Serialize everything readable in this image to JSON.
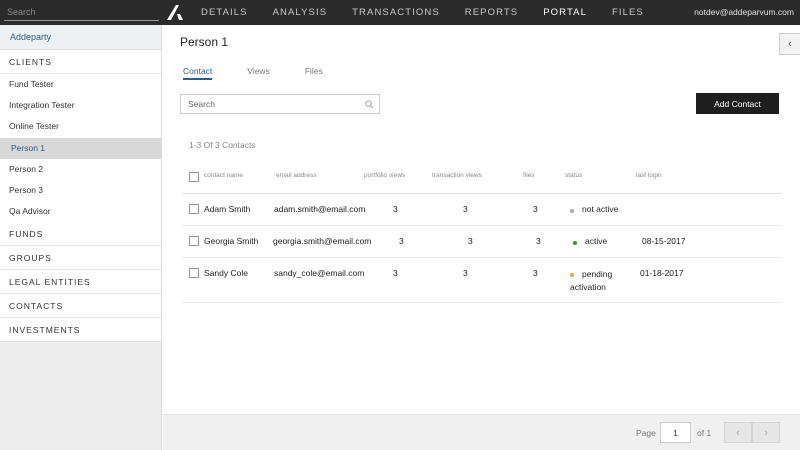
{
  "topbar": {
    "search_placeholder": "Search",
    "nav": [
      "DETAILS",
      "ANALYSIS",
      "TRANSACTIONS",
      "REPORTS",
      "PORTAL",
      "FILES"
    ],
    "active_nav": "PORTAL",
    "user_email": "notdev@addeparvum.com"
  },
  "sidebar": {
    "firm": "Addeparty",
    "clients_header": "CLIENTS",
    "clients": [
      "Fund Tester",
      "Integration Tester",
      "Online Tester",
      "Person 1",
      "Person 2",
      "Person 3",
      "Qa Advisor"
    ],
    "selected_client": "Person 1",
    "sections": [
      "FUNDS",
      "GROUPS",
      "LEGAL ENTITIES",
      "CONTACTS",
      "INVESTMENTS"
    ]
  },
  "main": {
    "title": "Person 1",
    "tabs": [
      "Contact",
      "Views",
      "Files"
    ],
    "active_tab": "Contact",
    "search_placeholder": "Search",
    "add_button": "Add Contact",
    "count_text": "1-3 Of 3 Contacts",
    "columns": [
      "contact name",
      "email address",
      "portfolio views",
      "transaction views",
      "files",
      "status",
      "last login"
    ],
    "rows": [
      {
        "name": "Adam Smith",
        "email": "adam.smith@email.com",
        "portfolio_views": "3",
        "transaction_views": "3",
        "files": "3",
        "status": "not active",
        "status_color": "#aaaaaa",
        "last_login": ""
      },
      {
        "name": "Georgia Smith",
        "email": "georgia.smith@email.com",
        "portfolio_views": "3",
        "transaction_views": "3",
        "files": "3",
        "status": "active",
        "status_color": "#2e9a2e",
        "last_login": "08-15-2017"
      },
      {
        "name": "Sandy Cole",
        "email": "sandy_cole@email.com",
        "portfolio_views": "3",
        "transaction_views": "3",
        "files": "3",
        "status_line1": "pending",
        "status_line2": "activation",
        "status_color": "#e0b020",
        "last_login": "01-18-2017"
      }
    ]
  },
  "pagination": {
    "page_label": "Page",
    "current_page": "1",
    "of_text": "of 1"
  },
  "icons": {
    "collapse_left": "chevron-left-icon",
    "search": "search-icon",
    "prev": "chevron-left-icon",
    "next": "chevron-right-icon"
  }
}
